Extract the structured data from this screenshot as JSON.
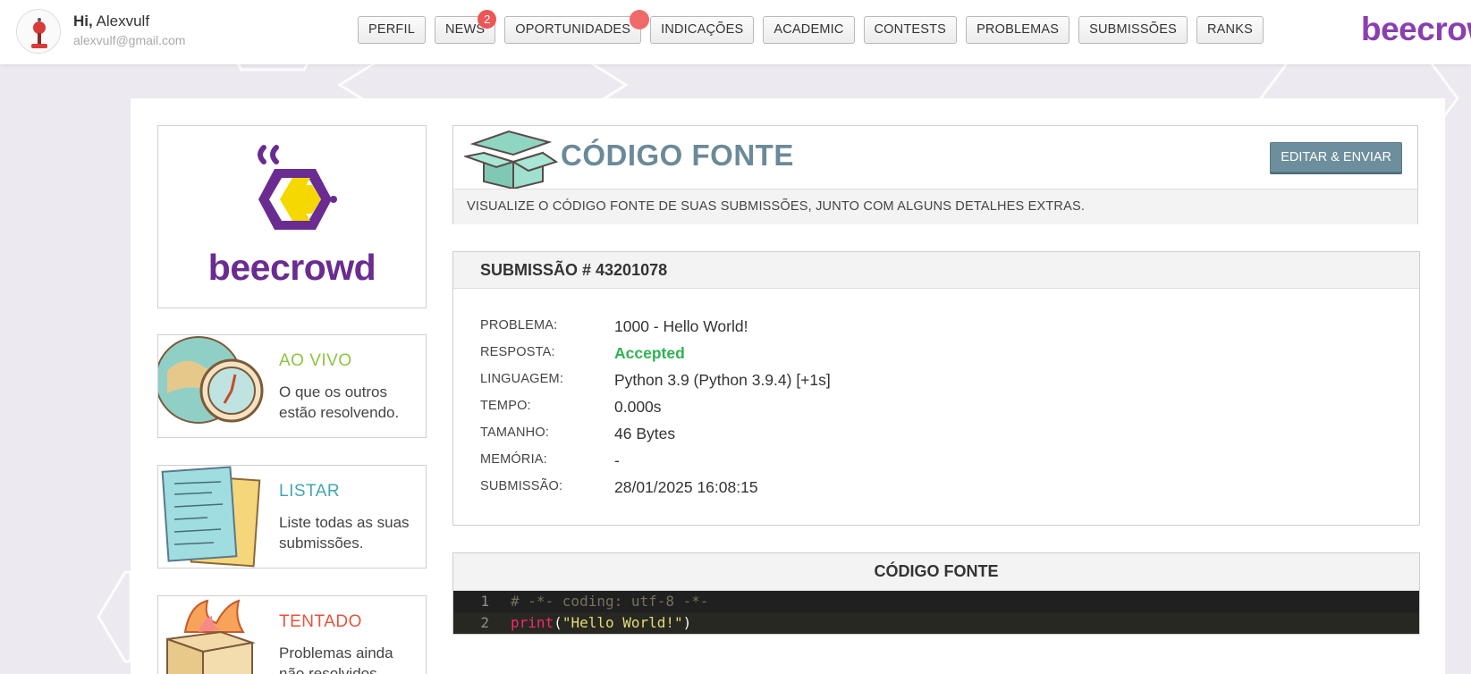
{
  "header": {
    "greeting": "Hi,",
    "user_name": "Alexvulf",
    "user_email": "alexvulf@gmail.com",
    "brand": "beecrow",
    "nav": [
      {
        "label": "PERFIL"
      },
      {
        "label": "NEWS",
        "badge": "2"
      },
      {
        "label": "OPORTUNIDADES"
      },
      {
        "label": "INDICAÇÕES"
      },
      {
        "label": "ACADEMIC"
      },
      {
        "label": "CONTESTS"
      },
      {
        "label": "PROBLEMAS"
      },
      {
        "label": "SUBMISSÕES"
      },
      {
        "label": "RANKS"
      }
    ]
  },
  "sidebar": {
    "logo_text": "beecrowd",
    "cards": [
      {
        "title": "AO VIVO",
        "desc": "O que os outros estão resolvendo.",
        "color": "#8cc43f",
        "icon": "globe-clock-icon"
      },
      {
        "title": "LISTAR",
        "desc": "Liste todas as suas submissões.",
        "color": "#3fa5b5",
        "icon": "documents-icon"
      },
      {
        "title": "TENTADO",
        "desc": "Problemas ainda não resolvidos.",
        "color": "#e8533b",
        "icon": "burning-box-icon"
      }
    ]
  },
  "page": {
    "title": "CÓDIGO FONTE",
    "subtitle": "VISUALIZE O CÓDIGO FONTE DE SUAS SUBMISSÕES, JUNTO COM ALGUNS DETALHES EXTRAS.",
    "edit_button": "EDITAR & ENVIAR"
  },
  "submission": {
    "header": "SUBMISSÃO # 43201078",
    "details": [
      {
        "label": "PROBLEMA:",
        "value": "1000 - Hello World!"
      },
      {
        "label": "RESPOSTA:",
        "value": "Accepted"
      },
      {
        "label": "LINGUAGEM:",
        "value": "Python 3.9 (Python 3.9.4) [+1s]"
      },
      {
        "label": "TEMPO:",
        "value": "0.000s"
      },
      {
        "label": "TAMANHO:",
        "value": "46 Bytes"
      },
      {
        "label": "MEMÓRIA:",
        "value": "-"
      },
      {
        "label": "SUBMISSÃO:",
        "value": "28/01/2025 16:08:15"
      }
    ]
  },
  "code": {
    "header": "CÓDIGO FONTE",
    "lines": [
      {
        "number": "1",
        "comment": "# -*- coding: utf-8 -*-"
      },
      {
        "number": "2",
        "fn": "print",
        "open": "(",
        "str": "\"Hello World!\"",
        "close": ")"
      }
    ]
  },
  "colors": {
    "brand_purple": "#8a3fb0",
    "accepted_green": "#2eb352",
    "title_slate": "#6b8a99",
    "badge_red": "#ee5555"
  }
}
